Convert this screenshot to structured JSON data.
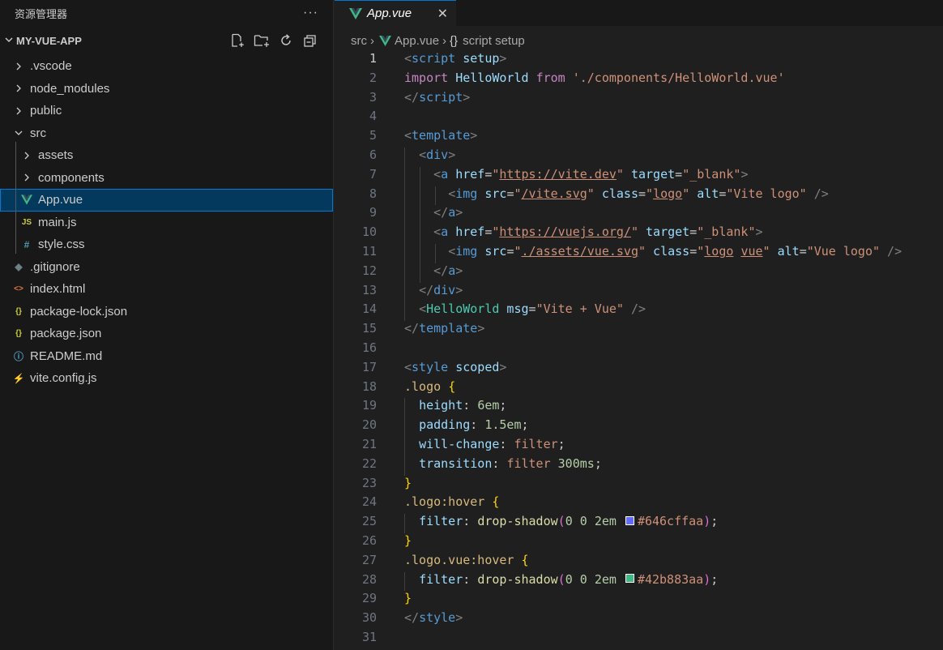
{
  "explorer": {
    "title": "资源管理器",
    "more": "···",
    "project": "MY-VUE-APP",
    "items": [
      {
        "label": ".vscode",
        "kind": "folder",
        "open": false,
        "depth": 0
      },
      {
        "label": "node_modules",
        "kind": "folder",
        "open": false,
        "depth": 0
      },
      {
        "label": "public",
        "kind": "folder",
        "open": false,
        "depth": 0
      },
      {
        "label": "src",
        "kind": "folder",
        "open": true,
        "depth": 0
      },
      {
        "label": "assets",
        "kind": "folder",
        "open": false,
        "depth": 1
      },
      {
        "label": "components",
        "kind": "folder",
        "open": false,
        "depth": 1
      },
      {
        "label": "App.vue",
        "kind": "file",
        "icon": "vue-icon",
        "glyph": "V",
        "color": "#41b883",
        "depth": 1,
        "selected": true
      },
      {
        "label": "main.js",
        "kind": "file",
        "icon": "js-icon",
        "glyph": "JS",
        "color": "#cbcb41",
        "depth": 1
      },
      {
        "label": "style.css",
        "kind": "file",
        "icon": "css-icon",
        "glyph": "#",
        "color": "#519aba",
        "depth": 1
      },
      {
        "label": ".gitignore",
        "kind": "file",
        "icon": "git-icon",
        "glyph": "◆",
        "color": "#6d8086",
        "depth": 0
      },
      {
        "label": "index.html",
        "kind": "file",
        "icon": "html-icon",
        "glyph": "<>",
        "color": "#e37933",
        "depth": 0
      },
      {
        "label": "package-lock.json",
        "kind": "file",
        "icon": "json-icon",
        "glyph": "{}",
        "color": "#cbcb41",
        "depth": 0
      },
      {
        "label": "package.json",
        "kind": "file",
        "icon": "json-icon",
        "glyph": "{}",
        "color": "#cbcb41",
        "depth": 0
      },
      {
        "label": "README.md",
        "kind": "file",
        "icon": "info-icon",
        "glyph": "ⓘ",
        "color": "#519aba",
        "depth": 0
      },
      {
        "label": "vite.config.js",
        "kind": "file",
        "icon": "vite-icon",
        "glyph": "⚡",
        "color": "#ffc517",
        "depth": 0
      }
    ]
  },
  "tab": {
    "label": "App.vue",
    "close": "✕"
  },
  "breadcrumb": {
    "folder": "src",
    "sep": "›",
    "file": "App.vue",
    "symbol_icon": "{}",
    "symbol": "script setup"
  },
  "code": {
    "current_line": 1,
    "lines": [
      [
        [
          "<",
          "#808080"
        ],
        [
          "script",
          "#569cd6"
        ],
        [
          " setup",
          "#9cdcfe"
        ],
        [
          ">",
          "#808080"
        ]
      ],
      [
        [
          "import",
          "#c586c0"
        ],
        [
          " HelloWorld ",
          "#9cdcfe"
        ],
        [
          "from",
          "#c586c0"
        ],
        [
          " ",
          "#cccccc"
        ],
        [
          "'./components/HelloWorld.vue'",
          "#ce9178"
        ]
      ],
      [
        [
          "</",
          "#808080"
        ],
        [
          "script",
          "#569cd6"
        ],
        [
          ">",
          "#808080"
        ]
      ],
      [],
      [
        [
          "<",
          "#808080"
        ],
        [
          "template",
          "#569cd6"
        ],
        [
          ">",
          "#808080"
        ]
      ],
      [
        [
          "  ",
          "#cccccc"
        ],
        [
          "<",
          "#808080"
        ],
        [
          "div",
          "#569cd6"
        ],
        [
          ">",
          "#808080"
        ]
      ],
      [
        [
          "    ",
          "#cccccc"
        ],
        [
          "<",
          "#808080"
        ],
        [
          "a",
          "#569cd6"
        ],
        [
          " href",
          "#9cdcfe"
        ],
        [
          "=",
          "#cccccc"
        ],
        [
          "\"",
          "#ce9178"
        ],
        [
          "https://vite.dev",
          "#ce9178",
          "u"
        ],
        [
          "\"",
          "#ce9178"
        ],
        [
          " target",
          "#9cdcfe"
        ],
        [
          "=",
          "#cccccc"
        ],
        [
          "\"_blank\"",
          "#ce9178"
        ],
        [
          ">",
          "#808080"
        ]
      ],
      [
        [
          "      ",
          "#cccccc"
        ],
        [
          "<",
          "#808080"
        ],
        [
          "img",
          "#569cd6"
        ],
        [
          " src",
          "#9cdcfe"
        ],
        [
          "=",
          "#cccccc"
        ],
        [
          "\"",
          "#ce9178"
        ],
        [
          "/vite.svg",
          "#ce9178",
          "u"
        ],
        [
          "\"",
          "#ce9178"
        ],
        [
          " class",
          "#9cdcfe"
        ],
        [
          "=",
          "#cccccc"
        ],
        [
          "\"",
          "#ce9178"
        ],
        [
          "logo",
          "#ce9178",
          "u"
        ],
        [
          "\"",
          "#ce9178"
        ],
        [
          " alt",
          "#9cdcfe"
        ],
        [
          "=",
          "#cccccc"
        ],
        [
          "\"Vite logo\"",
          "#ce9178"
        ],
        [
          " />",
          "#808080"
        ]
      ],
      [
        [
          "    ",
          "#cccccc"
        ],
        [
          "</",
          "#808080"
        ],
        [
          "a",
          "#569cd6"
        ],
        [
          ">",
          "#808080"
        ]
      ],
      [
        [
          "    ",
          "#cccccc"
        ],
        [
          "<",
          "#808080"
        ],
        [
          "a",
          "#569cd6"
        ],
        [
          " href",
          "#9cdcfe"
        ],
        [
          "=",
          "#cccccc"
        ],
        [
          "\"",
          "#ce9178"
        ],
        [
          "https://vuejs.org/",
          "#ce9178",
          "u"
        ],
        [
          "\"",
          "#ce9178"
        ],
        [
          " target",
          "#9cdcfe"
        ],
        [
          "=",
          "#cccccc"
        ],
        [
          "\"_blank\"",
          "#ce9178"
        ],
        [
          ">",
          "#808080"
        ]
      ],
      [
        [
          "      ",
          "#cccccc"
        ],
        [
          "<",
          "#808080"
        ],
        [
          "img",
          "#569cd6"
        ],
        [
          " src",
          "#9cdcfe"
        ],
        [
          "=",
          "#cccccc"
        ],
        [
          "\"",
          "#ce9178"
        ],
        [
          "./assets/vue.svg",
          "#ce9178",
          "u"
        ],
        [
          "\"",
          "#ce9178"
        ],
        [
          " class",
          "#9cdcfe"
        ],
        [
          "=",
          "#cccccc"
        ],
        [
          "\"",
          "#ce9178"
        ],
        [
          "logo",
          "#ce9178",
          "u"
        ],
        [
          " ",
          "#ce9178"
        ],
        [
          "vue",
          "#ce9178",
          "u"
        ],
        [
          "\"",
          "#ce9178"
        ],
        [
          " alt",
          "#9cdcfe"
        ],
        [
          "=",
          "#cccccc"
        ],
        [
          "\"Vue logo\"",
          "#ce9178"
        ],
        [
          " />",
          "#808080"
        ]
      ],
      [
        [
          "    ",
          "#cccccc"
        ],
        [
          "</",
          "#808080"
        ],
        [
          "a",
          "#569cd6"
        ],
        [
          ">",
          "#808080"
        ]
      ],
      [
        [
          "  ",
          "#cccccc"
        ],
        [
          "</",
          "#808080"
        ],
        [
          "div",
          "#569cd6"
        ],
        [
          ">",
          "#808080"
        ]
      ],
      [
        [
          "  ",
          "#cccccc"
        ],
        [
          "<",
          "#808080"
        ],
        [
          "HelloWorld",
          "#4ec9b0"
        ],
        [
          " msg",
          "#9cdcfe"
        ],
        [
          "=",
          "#cccccc"
        ],
        [
          "\"Vite + Vue\"",
          "#ce9178"
        ],
        [
          " />",
          "#808080"
        ]
      ],
      [
        [
          "</",
          "#808080"
        ],
        [
          "template",
          "#569cd6"
        ],
        [
          ">",
          "#808080"
        ]
      ],
      [],
      [
        [
          "<",
          "#808080"
        ],
        [
          "style",
          "#569cd6"
        ],
        [
          " scoped",
          "#9cdcfe"
        ],
        [
          ">",
          "#808080"
        ]
      ],
      [
        [
          ".logo",
          "#d7ba7d"
        ],
        [
          " ",
          "#cccccc"
        ],
        [
          "{",
          "#ffd700"
        ]
      ],
      [
        [
          "  ",
          "#cccccc"
        ],
        [
          "height",
          "#9cdcfe"
        ],
        [
          ": ",
          "#cccccc"
        ],
        [
          "6em",
          "#b5cea8"
        ],
        [
          ";",
          "#cccccc"
        ]
      ],
      [
        [
          "  ",
          "#cccccc"
        ],
        [
          "padding",
          "#9cdcfe"
        ],
        [
          ": ",
          "#cccccc"
        ],
        [
          "1.5em",
          "#b5cea8"
        ],
        [
          ";",
          "#cccccc"
        ]
      ],
      [
        [
          "  ",
          "#cccccc"
        ],
        [
          "will-change",
          "#9cdcfe"
        ],
        [
          ": ",
          "#cccccc"
        ],
        [
          "filter",
          "#ce9178"
        ],
        [
          ";",
          "#cccccc"
        ]
      ],
      [
        [
          "  ",
          "#cccccc"
        ],
        [
          "transition",
          "#9cdcfe"
        ],
        [
          ": ",
          "#cccccc"
        ],
        [
          "filter ",
          "#ce9178"
        ],
        [
          "300ms",
          "#b5cea8"
        ],
        [
          ";",
          "#cccccc"
        ]
      ],
      [
        [
          "}",
          "#ffd700"
        ]
      ],
      [
        [
          ".logo:hover",
          "#d7ba7d"
        ],
        [
          " ",
          "#cccccc"
        ],
        [
          "{",
          "#ffd700"
        ]
      ],
      [
        [
          "  ",
          "#cccccc"
        ],
        [
          "filter",
          "#9cdcfe"
        ],
        [
          ": ",
          "#cccccc"
        ],
        [
          "drop-shadow",
          "#dcdcaa"
        ],
        [
          "(",
          "#da70d6"
        ],
        [
          "0 ",
          "#b5cea8"
        ],
        [
          "0 ",
          "#b5cea8"
        ],
        [
          "2em ",
          "#b5cea8"
        ],
        [
          "",
          "#cccccc",
          "swatch:#646cff"
        ],
        [
          "#646cffaa",
          "#ce9178"
        ],
        [
          ")",
          "#da70d6"
        ],
        [
          ";",
          "#cccccc"
        ]
      ],
      [
        [
          "}",
          "#ffd700"
        ]
      ],
      [
        [
          ".logo.vue:hover",
          "#d7ba7d"
        ],
        [
          " ",
          "#cccccc"
        ],
        [
          "{",
          "#ffd700"
        ]
      ],
      [
        [
          "  ",
          "#cccccc"
        ],
        [
          "filter",
          "#9cdcfe"
        ],
        [
          ": ",
          "#cccccc"
        ],
        [
          "drop-shadow",
          "#dcdcaa"
        ],
        [
          "(",
          "#da70d6"
        ],
        [
          "0 ",
          "#b5cea8"
        ],
        [
          "0 ",
          "#b5cea8"
        ],
        [
          "2em ",
          "#b5cea8"
        ],
        [
          "",
          "#cccccc",
          "swatch:#42b883"
        ],
        [
          "#42b883aa",
          "#ce9178"
        ],
        [
          ")",
          "#da70d6"
        ],
        [
          ";",
          "#cccccc"
        ]
      ],
      [
        [
          "}",
          "#ffd700"
        ]
      ],
      [
        [
          "</",
          "#808080"
        ],
        [
          "style",
          "#569cd6"
        ],
        [
          ">",
          "#808080"
        ]
      ],
      []
    ]
  }
}
